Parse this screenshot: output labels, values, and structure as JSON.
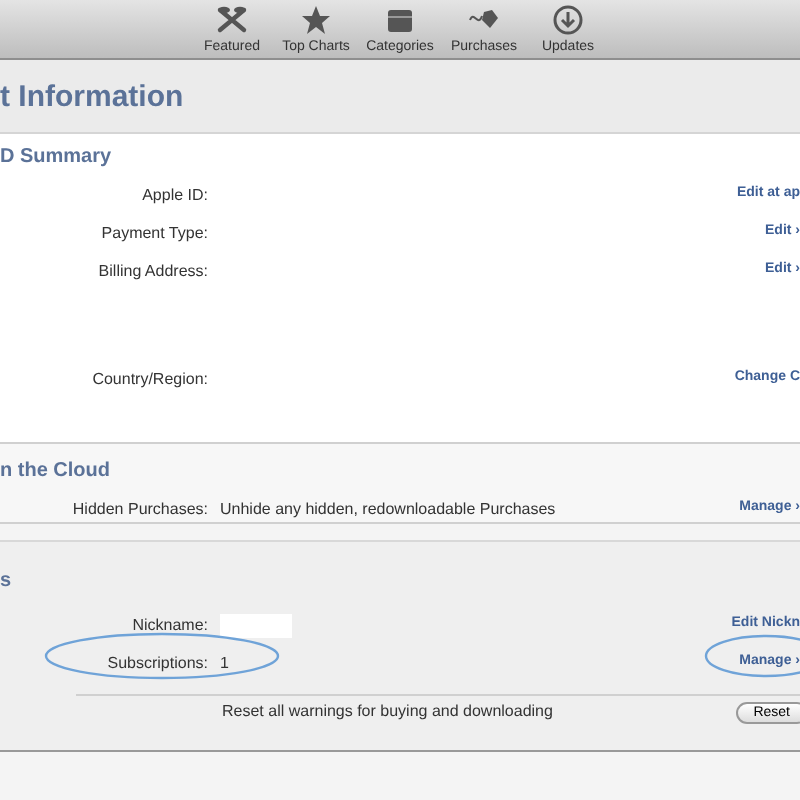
{
  "toolbar": [
    {
      "label": "Featured"
    },
    {
      "label": "Top Charts"
    },
    {
      "label": "Categories"
    },
    {
      "label": "Purchases"
    },
    {
      "label": "Updates"
    }
  ],
  "title": "t Information",
  "sections": [
    {
      "heading": "D Summary",
      "rows": [
        {
          "kind": "text",
          "label": "Apple ID:",
          "link": "Edit at ap"
        },
        {
          "kind": "text",
          "label": "Payment Type:",
          "link": "Edit ›"
        },
        {
          "kind": "address",
          "label": "Billing Address:",
          "link": "Edit ›"
        },
        {
          "kind": "text",
          "label": "Country/Region:",
          "link": "Change C"
        }
      ]
    },
    {
      "heading": "n the Cloud",
      "rows": [
        {
          "kind": "text",
          "label": "Hidden Purchases:",
          "value": "Unhide any hidden, redownloadable Purchases",
          "link": "Manage ›"
        }
      ]
    },
    {
      "heading": "s",
      "rows": [
        {
          "kind": "field",
          "label": "Nickname:",
          "link": "Edit Nickn"
        },
        {
          "kind": "text",
          "label": "Subscriptions:",
          "value": "1",
          "link": "Manage ›",
          "circled": true
        }
      ],
      "reset": {
        "text": "Reset all warnings for buying and downloading",
        "button": "Reset"
      }
    }
  ]
}
